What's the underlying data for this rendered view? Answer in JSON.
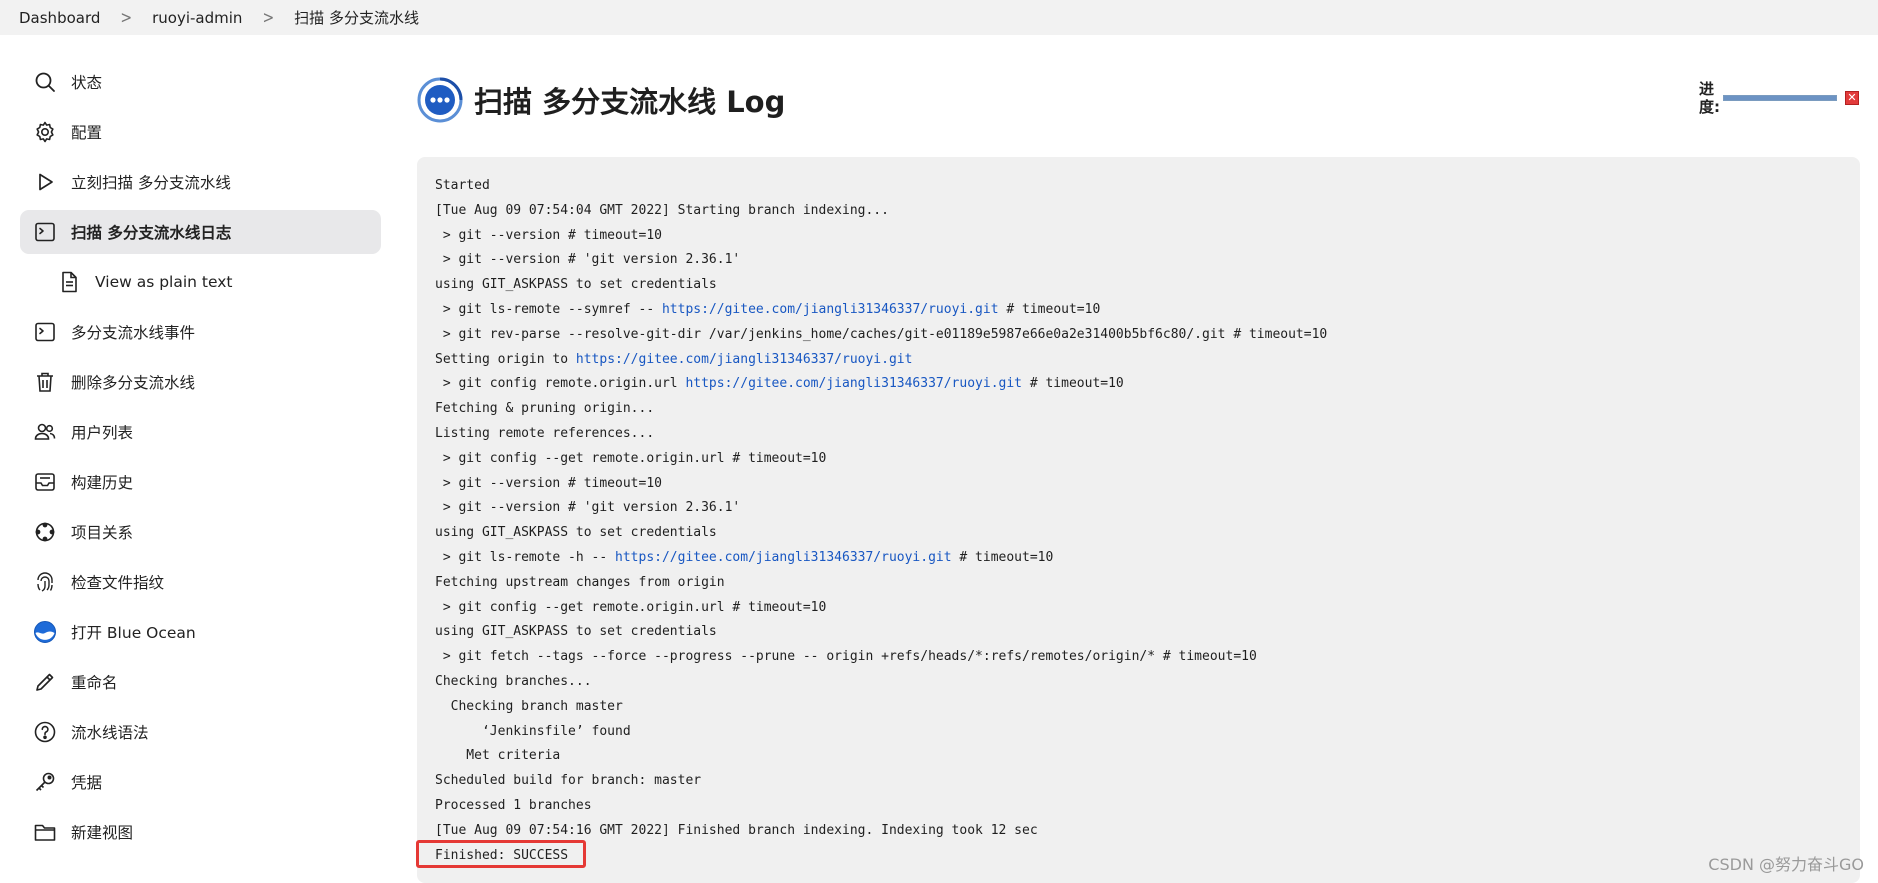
{
  "breadcrumb": {
    "items": [
      "Dashboard",
      "ruoyi-admin",
      "扫描 多分支流水线"
    ],
    "separator": ">"
  },
  "sidebar": {
    "items": [
      {
        "label": "状态",
        "icon": "search-icon"
      },
      {
        "label": "配置",
        "icon": "gear-icon"
      },
      {
        "label": "立刻扫描 多分支流水线",
        "icon": "play-icon"
      },
      {
        "label": "扫描 多分支流水线日志",
        "icon": "terminal-icon",
        "active": true
      },
      {
        "label": "View as plain text",
        "icon": "document-icon",
        "sub": true
      },
      {
        "label": "多分支流水线事件",
        "icon": "terminal-icon"
      },
      {
        "label": "删除多分支流水线",
        "icon": "trash-icon"
      },
      {
        "label": "用户列表",
        "icon": "users-icon"
      },
      {
        "label": "构建历史",
        "icon": "inbox-icon"
      },
      {
        "label": "项目关系",
        "icon": "relationship-icon"
      },
      {
        "label": "检查文件指纹",
        "icon": "fingerprint-icon"
      },
      {
        "label": "打开 Blue Ocean",
        "icon": "blue-ocean-icon"
      },
      {
        "label": "重命名",
        "icon": "pencil-icon"
      },
      {
        "label": "流水线语法",
        "icon": "help-icon"
      },
      {
        "label": "凭据",
        "icon": "key-icon"
      },
      {
        "label": "新建视图",
        "icon": "folder-icon"
      }
    ]
  },
  "main": {
    "title": "扫描 多分支流水线 Log",
    "status_icon": "in-progress-icon"
  },
  "progress": {
    "label": "进度:",
    "fraction": 1.0,
    "stop_icon": "stop-icon"
  },
  "console": {
    "lines": [
      [
        {
          "t": "Started"
        }
      ],
      [
        {
          "t": "[Tue Aug 09 07:54:04 GMT 2022] Starting branch indexing..."
        }
      ],
      [
        {
          "t": " > git --version # timeout=10"
        }
      ],
      [
        {
          "t": " > git --version # 'git version 2.36.1'"
        }
      ],
      [
        {
          "t": "using GIT_ASKPASS to set credentials"
        }
      ],
      [
        {
          "t": " > git ls-remote --symref -- "
        },
        {
          "t": "https://gitee.com/jiangli31346337/ruoyi.git",
          "link": true
        },
        {
          "t": " # timeout=10"
        }
      ],
      [
        {
          "t": " > git rev-parse --resolve-git-dir /var/jenkins_home/caches/git-e01189e5987e66e0a2e31400b5bf6c80/.git # timeout=10"
        }
      ],
      [
        {
          "t": "Setting origin to "
        },
        {
          "t": "https://gitee.com/jiangli31346337/ruoyi.git",
          "link": true
        }
      ],
      [
        {
          "t": " > git config remote.origin.url "
        },
        {
          "t": "https://gitee.com/jiangli31346337/ruoyi.git",
          "link": true
        },
        {
          "t": " # timeout=10"
        }
      ],
      [
        {
          "t": "Fetching & pruning origin..."
        }
      ],
      [
        {
          "t": "Listing remote references..."
        }
      ],
      [
        {
          "t": " > git config --get remote.origin.url # timeout=10"
        }
      ],
      [
        {
          "t": " > git --version # timeout=10"
        }
      ],
      [
        {
          "t": " > git --version # 'git version 2.36.1'"
        }
      ],
      [
        {
          "t": "using GIT_ASKPASS to set credentials"
        }
      ],
      [
        {
          "t": " > git ls-remote -h -- "
        },
        {
          "t": "https://gitee.com/jiangli31346337/ruoyi.git",
          "link": true
        },
        {
          "t": " # timeout=10"
        }
      ],
      [
        {
          "t": "Fetching upstream changes from origin"
        }
      ],
      [
        {
          "t": " > git config --get remote.origin.url # timeout=10"
        }
      ],
      [
        {
          "t": "using GIT_ASKPASS to set credentials"
        }
      ],
      [
        {
          "t": " > git fetch --tags --force --progress --prune -- origin +refs/heads/*:refs/remotes/origin/* # timeout=10"
        }
      ],
      [
        {
          "t": "Checking branches..."
        }
      ],
      [
        {
          "t": "  Checking branch master"
        }
      ],
      [
        {
          "t": "      ‘Jenkinsfile’ found"
        }
      ],
      [
        {
          "t": "    Met criteria"
        }
      ],
      [
        {
          "t": "Scheduled build for branch: master"
        }
      ],
      [
        {
          "t": "Processed 1 branches"
        }
      ],
      [
        {
          "t": "[Tue Aug 09 07:54:16 GMT 2022] Finished branch indexing. Indexing took 12 sec"
        }
      ],
      [
        {
          "t": "Finished: SUCCESS"
        }
      ]
    ]
  },
  "watermark": "CSDN @努力奋斗GO",
  "colors": {
    "link": "#1857c2",
    "highlight_border": "#e53935",
    "active_item_bg": "#e8e8ea",
    "console_bg": "#f0f0f0"
  }
}
